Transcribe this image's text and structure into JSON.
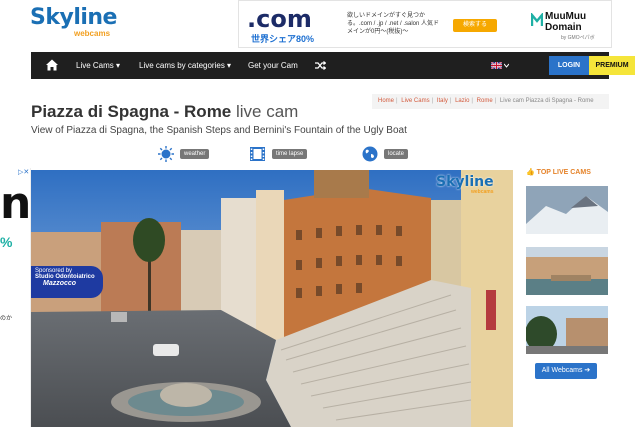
{
  "logo": {
    "name": "Skyline",
    "sub": "webcams"
  },
  "ad": {
    "headline": ".com",
    "share": "世界シェア80%",
    "text": "欲しいドメインがすぐ見つかる。.com / .jp / .net / .salon 人気ドメインが0円〜(税抜)〜",
    "button": "検索する",
    "brand": "MuuMuu\nDomain",
    "brand_line1": "MuuMuu",
    "brand_line2": "Domain",
    "gmo": "by GMOペパボ"
  },
  "nav": {
    "items": [
      "Live Cams ▾",
      "Live cams by categories ▾",
      "Get your Cam"
    ],
    "login": "LOGIN",
    "premium": "PREMIUM"
  },
  "page": {
    "title_bold": "Piazza di Spagna - Rome",
    "title_light": " live cam",
    "subtitle": "View of Piazza di Spagna, the Spanish Steps and Bernini's Fountain of the Ugly Boat"
  },
  "breadcrumbs": [
    "Home",
    "Live Cams",
    "Italy",
    "Lazio",
    "Rome"
  ],
  "breadcrumb_current": "Live cam Piazza di Spagna - Rome",
  "tools": {
    "weather": "weather",
    "timelapse": "time lapse",
    "locate": "locate"
  },
  "cam": {
    "logo": "Skyline",
    "logo_sub": "webcams",
    "sponsor_l1": "Sponsored by",
    "sponsor_l2": "Studio Odontoiatrico",
    "sponsor_l3": "Mazzocco"
  },
  "side_ad": {
    "big": "n",
    "pct": "%",
    "jp": "のか"
  },
  "sidebar": {
    "heading": "TOP LIVE CAMS",
    "all_button": "All Webcams ➔"
  }
}
